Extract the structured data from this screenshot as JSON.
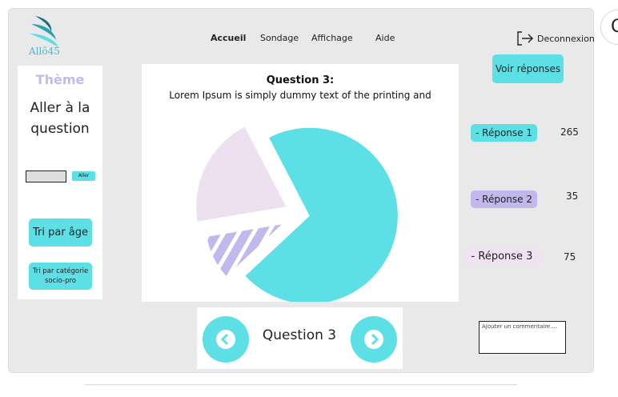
{
  "app": {
    "logo_text": "Allô45"
  },
  "nav": {
    "items": [
      "Accueil",
      "Sondage",
      "Affichage",
      "Aide"
    ],
    "active": "Accueil",
    "logout_label": "Deconnexion"
  },
  "sidebar": {
    "theme_title": "Thème",
    "goto_text": "Aller à la question",
    "goto_input_value": "",
    "goto_button_label": "Aller",
    "sort_age_label": "Tri par âge",
    "sort_category_label": "Tri par catégorie socio-pro"
  },
  "question": {
    "title": "Question 3:",
    "text": "Lorem Ipsum is simply dummy text of the printing and"
  },
  "chart_data": {
    "type": "pie",
    "categories": [
      "Réponse 1",
      "Réponse 2",
      "Réponse 3"
    ],
    "values": [
      265,
      35,
      75
    ],
    "colors": [
      "#5ce0e6",
      "#c2b8ee",
      "#ede0f1"
    ],
    "exploded": true,
    "hatched_category": "Réponse 2"
  },
  "results": {
    "show_button_label": "Voir réponses",
    "answers": [
      {
        "label": "- Réponse 1",
        "count": "265"
      },
      {
        "label": "- Réponse 2",
        "count": "35"
      },
      {
        "label": "- Réponse 3",
        "count": "75"
      }
    ]
  },
  "comment": {
    "placeholder": "Ajouter un commentaire...."
  },
  "navigator": {
    "label": "Question 3"
  },
  "colors": {
    "accent": "#5ce0e6",
    "lavender": "#c2b8ee",
    "pink": "#ede0f1",
    "logo": "#4fb8c4"
  }
}
